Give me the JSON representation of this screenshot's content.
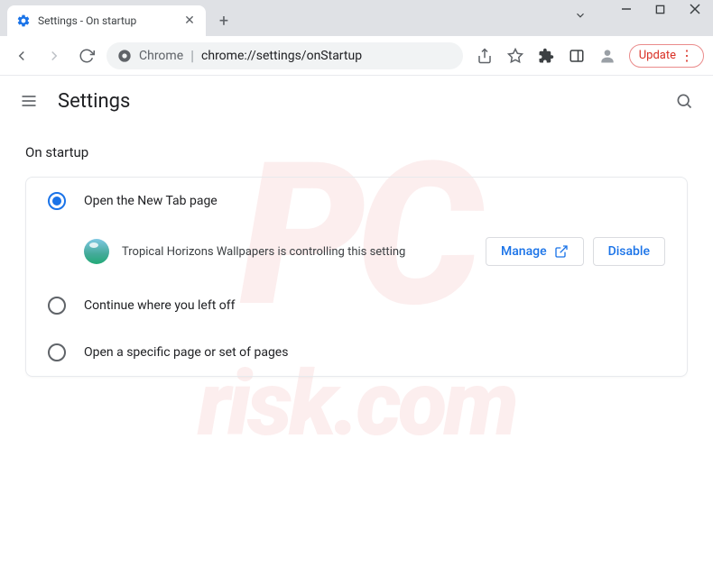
{
  "titlebar": {
    "tab_title": "Settings - On startup"
  },
  "urlbar": {
    "chrome_label": "Chrome",
    "url_path": "chrome://settings/onStartup",
    "update_label": "Update"
  },
  "header": {
    "title": "Settings"
  },
  "section": {
    "title": "On startup",
    "options": [
      {
        "label": "Open the New Tab page"
      },
      {
        "label": "Continue where you left off"
      },
      {
        "label": "Open a specific page or set of pages"
      }
    ],
    "extension_notice": "Tropical Horizons Wallpapers is controlling this setting",
    "manage_label": "Manage",
    "disable_label": "Disable"
  }
}
